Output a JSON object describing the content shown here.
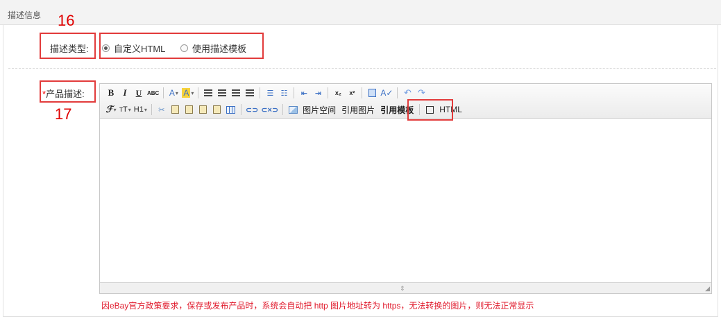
{
  "panel": {
    "title": "描述信息"
  },
  "annotations": {
    "num_16": "16",
    "num_17": "17"
  },
  "description_type": {
    "label": "描述类型:",
    "options": [
      {
        "label": "自定义HTML",
        "selected": true
      },
      {
        "label": "使用描述模板",
        "selected": false
      }
    ]
  },
  "product_description": {
    "required_mark": "*",
    "label": "产品描述:"
  },
  "toolbar": {
    "row1": {
      "bold": "B",
      "italic": "I",
      "underline": "U",
      "strike": "ABC",
      "font_color": "A",
      "highlight": "A",
      "superscript": "x²",
      "subscript": "x₂"
    },
    "row2": {
      "font_family": "ℱ",
      "font_size": "тT",
      "heading": "H1",
      "image_space": "图片空间",
      "quote_image": "引用图片",
      "quote_template": "引用模板",
      "html": "HTML"
    }
  },
  "notice": "因eBay官方政策要求，保存或发布产品时，系统会自动把 http 图片地址转为 https，无法转换的图片，则无法正常显示",
  "colors": {
    "accent_red": "#e23b3b",
    "notice_red": "#e0192b",
    "icon_blue": "#3a6fc4"
  }
}
